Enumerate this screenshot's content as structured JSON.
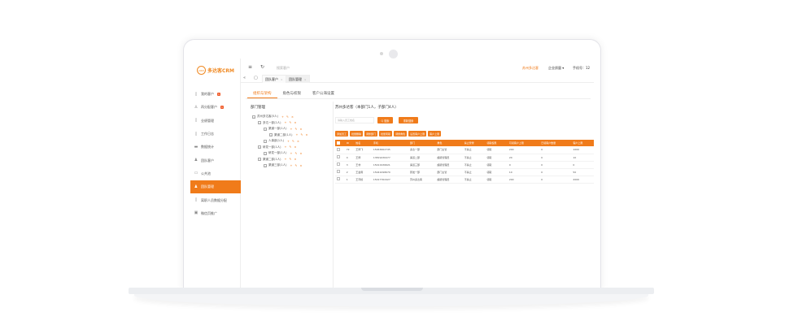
{
  "app": {
    "logo_mark": "CRM",
    "logo_text": "多达客CRM"
  },
  "sidebar": {
    "items": [
      {
        "label": "我的客户",
        "badge": "1",
        "icon": "doc-icon"
      },
      {
        "label": "再分配客户",
        "badge": "1",
        "icon": "user-icon"
      },
      {
        "label": "业绩管理",
        "badge": "",
        "icon": "doc-icon"
      },
      {
        "label": "工作日志",
        "badge": "",
        "icon": "doc-icon"
      },
      {
        "label": "数据统计",
        "badge": "",
        "icon": "chart-icon"
      },
      {
        "label": "团队客户",
        "badge": "",
        "icon": "team-icon"
      },
      {
        "label": "公共池",
        "badge": "",
        "icon": "pool-icon"
      },
      {
        "label": "团队管理",
        "badge": "",
        "icon": "team-icon"
      },
      {
        "label": "离职人员数据分配",
        "badge": "",
        "icon": "doc-icon"
      },
      {
        "label": "微信页推广",
        "badge": "",
        "icon": "image-icon"
      }
    ],
    "active_index": 7
  },
  "topbar": {
    "search_placeholder": "搜索客户",
    "right1": "苏州多达客",
    "right2": "企业质量 ▾",
    "right3": "手机号：12"
  },
  "tabs": [
    {
      "label": "团队客户"
    },
    {
      "label": "团队管理"
    }
  ],
  "subtabs": [
    "组织与架构",
    "角色与权限",
    "客户公海设置"
  ],
  "left_panel": {
    "title": "部门管理",
    "tree": [
      {
        "label": "苏州多达客(5人)",
        "level": 0
      },
      {
        "label": "多达一部(2人)",
        "level": 1
      },
      {
        "label": "渠道一部(1人)",
        "level": 2
      },
      {
        "label": "渠道二部(1人)",
        "level": 3
      },
      {
        "label": "人事部(1人)",
        "level": 2
      },
      {
        "label": "研发一部(1人)",
        "level": 1
      },
      {
        "label": "研发一部(1人)",
        "level": 2
      },
      {
        "label": "渠道二部(1人)",
        "level": 1
      },
      {
        "label": "渠道三部(1人)",
        "level": 2
      }
    ],
    "ops": "+ ✎ ×"
  },
  "right_panel": {
    "title": "苏州多达客（本部门1人，子部门4人）",
    "search_placeholder": "请输入员工姓名",
    "search_btn": "Q 搜索",
    "search2_btn": "重新搜索",
    "actions": [
      "添加员工",
      "批量删除",
      "调整部门",
      "批量离职",
      "调整角色",
      "设置客户上限",
      "客户上限"
    ],
    "columns": [
      "ID",
      "姓名",
      "手机",
      "部门",
      "角色",
      "禁止登录",
      "领取权限",
      "可领客户上限",
      "已领客户数量",
      "客户上限"
    ],
    "rows": [
      [
        "72",
        "王博飞",
        "15063662745",
        "多达一部",
        "部门主管",
        "不禁止",
        "领取",
        "200",
        "0",
        "1000"
      ],
      [
        "4",
        "王博",
        "13819436477",
        "渠道二部",
        "超级管理员",
        "不禁止",
        "领取",
        "20",
        "0",
        "10"
      ],
      [
        "3",
        "王非",
        "15011936621",
        "渠道三部",
        "超级管理员",
        "不禁止",
        "领取",
        "0",
        "0",
        "0"
      ],
      [
        "2",
        "王金雨",
        "15041098670",
        "研发一部",
        "部门主管",
        "不禁止",
        "领取",
        "10",
        "0",
        "50"
      ],
      [
        "1",
        "王育植",
        "15017762427",
        "苏州多达客",
        "超级管理员",
        "不禁止",
        "领取",
        "200",
        "0",
        "2000"
      ]
    ]
  }
}
